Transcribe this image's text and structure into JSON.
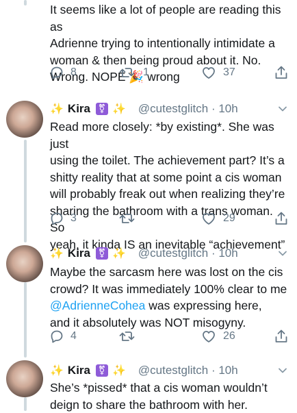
{
  "colors": {
    "link": "#1da1f2",
    "muted": "#657786",
    "badge": "#8e5bd8",
    "sparkle": "#f5b301"
  },
  "tweets": [
    {
      "text_lines": [
        "It seems like a lot of people are reading this as",
        "Adrienne trying to intentionally intimidate a",
        "woman & then being proud about it. No.",
        "Wrong. NOPE"
      ],
      "last_suffix": " wrong",
      "emoji": "🎉",
      "replies": "8",
      "retweets": "1",
      "likes": "37"
    },
    {
      "author": "Kira",
      "sparkle": "✨",
      "badge": "⚧",
      "handle": "@cutestglitch · 10h",
      "text_lines": [
        "Read more closely: *by existing*. She was just",
        "using the toilet. The achievement part? It’s a",
        "shitty reality that at some point a cis woman",
        "will probably freak out when realizing they’re",
        "sharing the bathroom with a trans woman. So",
        "yeah, it kinda IS an inevitable “achievement”"
      ],
      "replies": "3",
      "retweets": "",
      "likes": "29"
    },
    {
      "author": "Kira",
      "sparkle": "✨",
      "badge": "⚧",
      "handle": "@cutestglitch · 10h",
      "line1": "Maybe the sarcasm here was lost on the cis",
      "line2": "crowd? It was immediately 100% clear to me",
      "mention": "@AdrienneCohea",
      "line3_after": " was expressing here,",
      "line4": "and it absolutely was NOT misogyny.",
      "replies": "4",
      "retweets": "",
      "likes": "26"
    },
    {
      "author": "Kira",
      "sparkle": "✨",
      "badge": "⚧",
      "handle": "@cutestglitch · 10h",
      "text_lines": [
        "She’s *pissed* that a cis woman wouldn’t",
        "deign to share the bathroom with her."
      ]
    }
  ]
}
